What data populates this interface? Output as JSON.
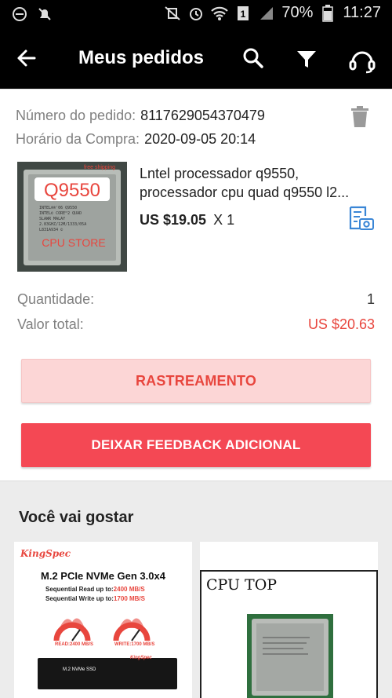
{
  "status_bar": {
    "battery": "70%",
    "time": "11:27",
    "sim": "1"
  },
  "app_bar": {
    "title": "Meus pedidos",
    "icons": [
      "back-arrow-icon",
      "search-icon",
      "filter-icon",
      "headset-icon"
    ]
  },
  "order": {
    "number_label": "Número do pedido:",
    "number_value": "8117629054370479",
    "time_label": "Horário da Compra:",
    "time_value": "2020-09-05 20:14"
  },
  "product": {
    "title_line1": "Lntel processador q9550,",
    "title_line2": "processador cpu quad q9550 l2...",
    "price": "US $19.05",
    "quantity": "X 1",
    "thumb": {
      "model": "Q9550",
      "store": "CPU STORE",
      "badge": "free shipping",
      "chip_lines": [
        "INTEL®®'06 Q9550",
        "INTEL© CORE™2 QUAD",
        "SLAWR MALAY",
        "2.83GHZ/12M/1333/05A",
        "L831A934 ©"
      ]
    }
  },
  "summary": {
    "quantity_label": "Quantidade:",
    "quantity_value": "1",
    "total_label": "Valor total:",
    "total_value": "US $20.63"
  },
  "buttons": {
    "track": "RASTREAMENTO",
    "feedback": "DEIXAR FEEDBACK ADICIONAL"
  },
  "recommendations": {
    "title": "Você vai gostar",
    "card1": {
      "brand": "KingSpec",
      "headline": "M.2 PCIe NVMe Gen 3.0x4",
      "read_prefix": "Sequential Read up to:",
      "read_value": "2400 MB/S",
      "write_prefix": "Sequential Write up to:",
      "write_value": "1700 MB/S",
      "gauge1": "READ:2400 MB/S",
      "gauge2": "WRITE:1700 MB/S",
      "stick_label": "M.2 NVMe SSD",
      "stick_brand": "KingSpec"
    },
    "card2": {
      "label": "CPU TOP"
    }
  },
  "colors": {
    "accent_red": "#f44854",
    "price_red": "#e8463e",
    "track_bg": "#fcd6d6",
    "icon_blue": "#3a86d6"
  }
}
